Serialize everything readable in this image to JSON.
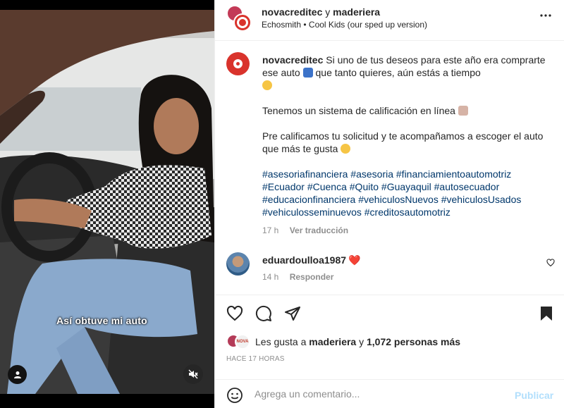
{
  "media": {
    "caption_overlay": "Así obtuve mi auto",
    "tag_icon": "user-tag-icon",
    "mute_icon": "speaker-muted-icon"
  },
  "header": {
    "author": "novacreditec",
    "connector": "y",
    "collaborator": "maderiera",
    "song_artist": "Echosmith",
    "dot": "•",
    "song_title": "Cool Kids (our sped up version)",
    "more_icon": "more-options-icon"
  },
  "caption": {
    "username": "novacreditec",
    "line1": "Si uno de tus deseos para este año era comprarte ese auto",
    "line1b": "que tanto quieres, aún estás a tiempo",
    "para2": "Tenemos un sistema de calificación en línea",
    "para3": "Pre calificamos tu solicitud y te acompañamos a escoger el auto que más te gusta",
    "hashtags": [
      "#asesoriafinanciera",
      "#asesoria",
      "#financiamientoautomotriz",
      "#Ecuador",
      "#Cuenca",
      "#Quito",
      "#Guayaquil",
      "#autosecuador",
      "#educacionfinanciera",
      "#vehiculosNuevos",
      "#vehiculosUsados",
      "#vehiculosseminuevos",
      "#creditosautomotriz"
    ],
    "age": "17 h",
    "see_translation": "Ver traducción"
  },
  "comment": {
    "username": "eduardoulloa1987",
    "heart": "❤️",
    "age": "14 h",
    "reply": "Responder",
    "like_icon": "heart-outline-icon"
  },
  "actions": {
    "like_icon": "heart-outline-icon",
    "comment_icon": "comment-icon",
    "share_icon": "send-icon",
    "save_icon": "bookmark-filled-icon"
  },
  "likes": {
    "prefix": "Les gusta a",
    "user": "maderiera",
    "connector": "y",
    "count": "1,072 personas más",
    "avatar2_text": "NOVA"
  },
  "timestamp": "HACE 17 HORAS",
  "comment_box": {
    "placeholder": "Agrega un comentario...",
    "publish": "Publicar",
    "emoji_icon": "smiley-icon"
  },
  "colors": {
    "hashtag": "#00376b",
    "brand_red": "#d9332c",
    "publish_disabled": "#b2dffc"
  }
}
